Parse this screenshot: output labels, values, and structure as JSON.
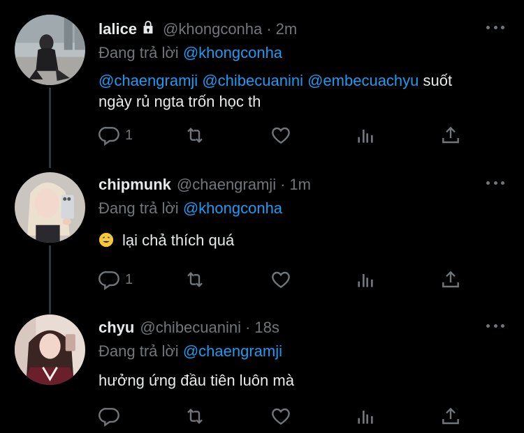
{
  "tweets": [
    {
      "name": "lalice",
      "protected": true,
      "handle": "@khongconha",
      "time": "2m",
      "reply_prefix": "Đang trả lời",
      "reply_to": "@khongconha",
      "mentions": [
        "@chaengramji",
        "@chibecuanini",
        "@embecuachyu"
      ],
      "text_line1_tail": "suốt",
      "text_line2": "ngày rủ ngta trốn học th",
      "reply_count": "1",
      "avatar_colors": {
        "bg": "#b9c2c6",
        "fg": "#2b2b2e"
      }
    },
    {
      "name": "chipmunk",
      "protected": false,
      "handle": "@chaengramji",
      "time": "1m",
      "reply_prefix": "Đang trả lời",
      "reply_to": "@khongconha",
      "emoji": "grinning-sweat-emoji",
      "text": "lại chả thích quá",
      "reply_count": "1",
      "avatar_colors": {
        "bg": "#cfc9c4",
        "fg": "#e9d8c4"
      }
    },
    {
      "name": "chyu",
      "protected": false,
      "handle": "@chibecuanini",
      "time": "18s",
      "reply_prefix": "Đang trả lời",
      "reply_to": "@chaengramji",
      "text": "hưởng ứng đầu tiên luôn mà",
      "reply_count": "",
      "avatar_colors": {
        "bg": "#e7d7cf",
        "fg": "#6a1f2a"
      }
    }
  ],
  "icons": {
    "reply": "reply-icon",
    "retweet": "retweet-icon",
    "like": "heart-icon",
    "views": "views-icon",
    "share": "share-icon",
    "more": "more-icon",
    "lock": "lock-icon"
  },
  "colors": {
    "background": "#000000",
    "text": "#e7e9ea",
    "muted": "#71767b",
    "link": "#1d9bf0"
  }
}
